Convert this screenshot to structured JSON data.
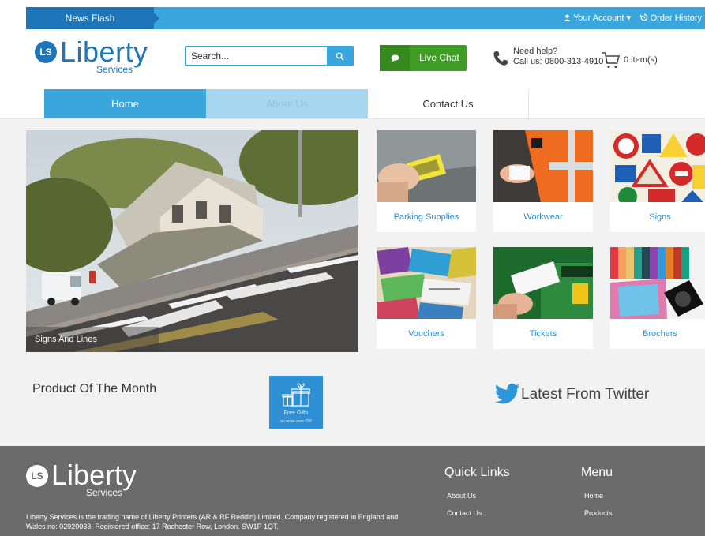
{
  "topbar": {
    "news_flash": "News Flash",
    "account": "Your Account",
    "order_history": "Order History"
  },
  "logo": {
    "mark": "LS",
    "brand": "Liberty",
    "sub": "Services"
  },
  "search": {
    "placeholder": "Search..."
  },
  "live_chat": {
    "label": "Live Chat"
  },
  "help": {
    "line1": "Need help?",
    "line2": "Call us: 0800-313-4910"
  },
  "cart": {
    "count_label": "0 item(s)"
  },
  "nav": {
    "tabs": [
      {
        "label": "Home"
      },
      {
        "label": "About Us"
      },
      {
        "label": "Contact Us"
      }
    ]
  },
  "hero": {
    "caption": "Signs And Lines"
  },
  "categories": [
    {
      "label": "Parking Supplies"
    },
    {
      "label": "Workwear"
    },
    {
      "label": "Signs"
    },
    {
      "label": "Vouchers"
    },
    {
      "label": "Tickets"
    },
    {
      "label": "Brochers"
    }
  ],
  "product_of_month": {
    "title": "Product Of The Month",
    "gift_line1": "Free Gifts",
    "gift_line2": "on order over £50"
  },
  "twitter": {
    "title": "Latest From Twitter"
  },
  "footer": {
    "logo_mark": "LS",
    "logo_brand": "Liberty",
    "logo_sub": "Services",
    "description": "Liberty Services is the trading name of Liberty Printers (AR & RF Reddin) Limited. Company registered in England and Wales no: 02920033. Registered office: 17 Rochester Row, London. SW1P 1QT.",
    "quick_links": {
      "title": "Quick Links",
      "items": [
        "About Us",
        "Contact Us"
      ]
    },
    "menu": {
      "title": "Menu",
      "items": [
        "Home",
        "Products"
      ]
    }
  },
  "colors": {
    "primary": "#3aa6dc",
    "dark_blue": "#1e76b9",
    "chat_green": "#3f9d25",
    "footer_grey": "#6b6b6b"
  }
}
